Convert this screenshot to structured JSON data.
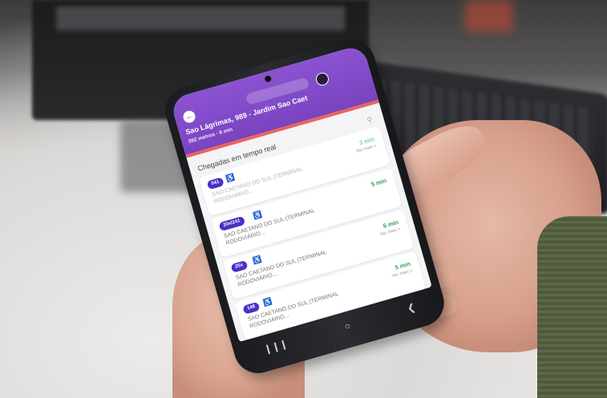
{
  "app": {
    "status_left": "",
    "status_right": "",
    "search_label": "",
    "stop_name": "Sao Lágrimas, 989 - Jardim Sao Caet",
    "stop_meta": "392 metros · 6 min",
    "section_title": "Chegadas em tempo real"
  },
  "arrivals": [
    {
      "route": "541",
      "destination": "SAO CAETANO DO SUL (TERMINAL RODOVIÁRIO...",
      "eta": "3 min",
      "more": "Ver mais >"
    },
    {
      "route": "20x/241",
      "destination": "SAO CAETANO DO SUL (TERMINAL RODOVIÁRIO...",
      "eta": "5 min",
      "more": ""
    },
    {
      "route": "25x",
      "destination": "SAO CAETANO DO SUL (TERMINAL RODOVIÁRIO...",
      "eta": "6 min",
      "more": "Ver mais >"
    },
    {
      "route": "148",
      "destination": "SAO CAETANO DO SUL (TERMINAL RODOVIÁRIO...",
      "eta": "5 min",
      "more": "Ver mais >"
    }
  ],
  "icons": {
    "back": "arrow-left-icon",
    "accessibility": "wheelchair-icon",
    "nav": [
      "recents-icon",
      "home-icon",
      "back-icon"
    ]
  },
  "colors": {
    "header": "#7a43c0",
    "header_stripe": "#e8655b",
    "route_badge": "#4b2fc7",
    "eta": "#2fa35a"
  }
}
